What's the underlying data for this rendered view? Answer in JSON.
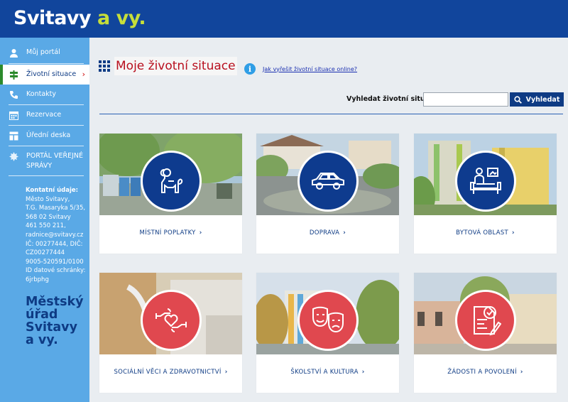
{
  "header": {
    "logo_main": "Svitavy",
    "logo_accent": "a vy."
  },
  "sidebar": {
    "items": [
      {
        "label": "Můj portál",
        "icon": "user-icon"
      },
      {
        "label": "Životní situace",
        "icon": "signpost-icon",
        "active": true
      },
      {
        "label": "Kontakty",
        "icon": "phone-icon"
      },
      {
        "label": "Rezervace",
        "icon": "calendar-icon"
      },
      {
        "label": "Úřední deska",
        "icon": "board-icon"
      },
      {
        "label": "PORTÁL VEŘEJNÉ SPRÁVY",
        "icon": "emblem-icon"
      }
    ],
    "contact": {
      "heading": "Kontatní údaje:",
      "lines": [
        "Město Svitavy,",
        "T.G. Masaryka 5/35,",
        "568 02 Svitavy",
        "461 550 211,",
        "radnice@svitavy.cz",
        "IČ: 00277444, DIČ:",
        "CZ00277444",
        "9005-520591/0100",
        "ID datové schránky:",
        "6jrbphg"
      ]
    },
    "logo_lines": [
      "Městský",
      "úřad",
      "Svitavy",
      "a vy."
    ]
  },
  "main": {
    "title": "Moje životní situace",
    "help_link": "Jak vyřešit životní situace online?",
    "search": {
      "label": "Vyhledat životní situaci:",
      "value": "",
      "button": "Vyhledat"
    },
    "cards": [
      {
        "label": "MÍSTNÍ POPLATKY",
        "icon": "dog-icon"
      },
      {
        "label": "DOPRAVA",
        "icon": "car-icon"
      },
      {
        "label": "BYTOVÁ OBLAST",
        "icon": "home-desk-icon"
      },
      {
        "label": "SOCIÁLNÍ VĚCI A ZDRAVOTNICTVÍ",
        "icon": "hands-heart-icon"
      },
      {
        "label": "ŠKOLSTVÍ A KULTURA",
        "icon": "theater-masks-icon"
      },
      {
        "label": "ŽÁDOSTI A POVOLENÍ",
        "icon": "document-approved-icon"
      }
    ]
  },
  "colors": {
    "header": "#11459c",
    "sidebar": "#5aa9e6",
    "accent_green": "#c6de3a",
    "title_red": "#b80f1e",
    "card_blue": "#0e3b8e",
    "card_red": "#e0484f"
  }
}
